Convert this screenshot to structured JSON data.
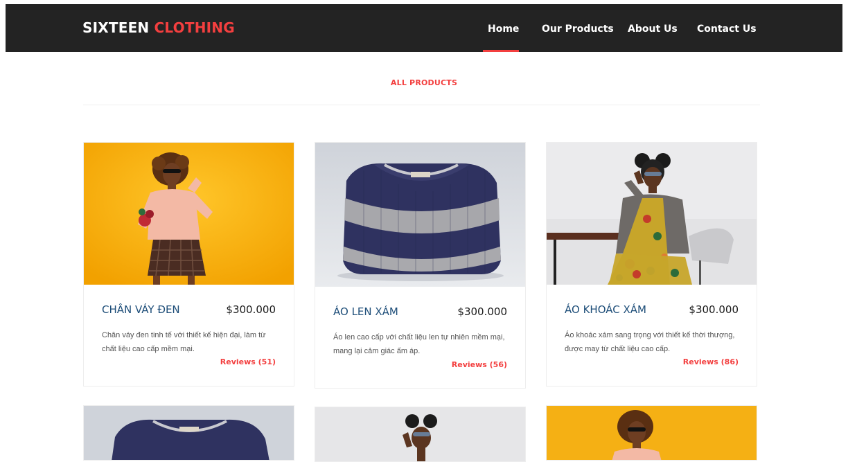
{
  "header": {
    "logo_main": "SIXTEEN",
    "logo_accent": "CLOTHING",
    "nav": [
      "Home",
      "Our Products",
      "About Us",
      "Contact Us"
    ],
    "active_nav": "Home"
  },
  "section": {
    "title": "ALL PRODUCTS"
  },
  "products": [
    {
      "name": "Chân váy đen",
      "price": "$300.000",
      "description": "Chân váy đen tinh tế với thiết kế hiện đại, làm từ chất liệu cao cấp mềm mại.",
      "reviews": "Reviews (51)"
    },
    {
      "name": "Áo len xám",
      "price": "$300.000",
      "description": "Áo len cao cấp với chất liệu len tự nhiên mềm mại, mang lại cảm giác ấm áp.",
      "reviews": "Reviews (56)"
    },
    {
      "name": "Áo khoác xám",
      "price": "$300.000",
      "description": "Áo khoác xám sang trọng với thiết kế thời thượng, được may từ chất liệu cao cấp.",
      "reviews": "Reviews (86)"
    }
  ],
  "colors": {
    "navbar": "#232323",
    "accent": "#f33f3f",
    "product_name": "#1e4e79"
  }
}
